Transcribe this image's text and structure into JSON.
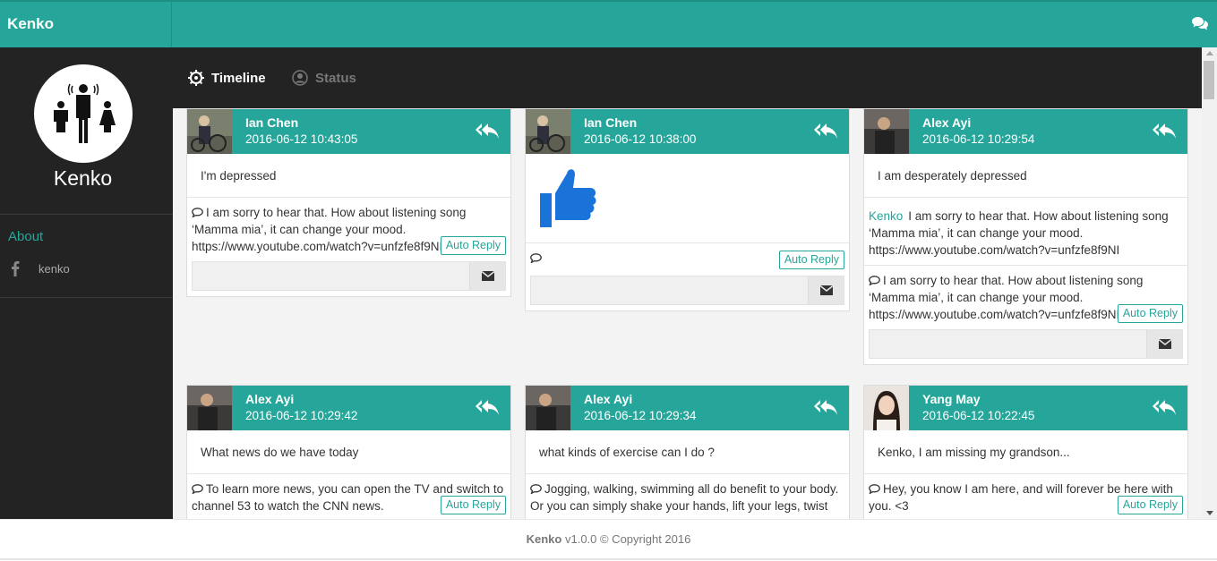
{
  "app": {
    "brand": "Kenko",
    "chat_icon": "comments-icon"
  },
  "sidebar": {
    "name": "Kenko",
    "about_label": "About",
    "facebook_label": "kenko",
    "facebook_icon": "facebook-icon"
  },
  "tabs": [
    {
      "label": "Timeline",
      "icon": "settings-wheel-icon",
      "active": true
    },
    {
      "label": "Status",
      "icon": "user-circle-icon",
      "active": false
    }
  ],
  "posts": [
    {
      "user": "Ian Chen",
      "time": "2016-06-12 10:43:05",
      "message": "I'm depressed",
      "replies": [
        {
          "prefix": "",
          "text": "I am sorry to hear that. How about listening song ‘Mamma mia’, it can change your mood. https://www.youtube.com/watch?v=unfzfe8f9NI",
          "button": "Auto Reply"
        }
      ]
    },
    {
      "user": "Ian Chen",
      "time": "2016-06-12 10:38:00",
      "message": "",
      "thumb": "thumbs-up-icon",
      "replies": [
        {
          "prefix": "",
          "text": "",
          "button": "Auto Reply"
        }
      ]
    },
    {
      "user": "Alex Ayi",
      "time": "2016-06-12 10:29:54",
      "message": "I am desperately depressed",
      "replies": [
        {
          "prefix": "Kenko",
          "text": "I am sorry to hear that. How about listening song ‘Mamma mia’, it can change your mood. https://www.youtube.com/watch?v=unfzfe8f9NI",
          "button": ""
        },
        {
          "prefix": "",
          "text": "I am sorry to hear that. How about listening song ‘Mamma mia’, it can change your mood. https://www.youtube.com/watch?v=unfzfe8f9NI",
          "button": "Auto Reply"
        }
      ]
    },
    {
      "user": "Alex Ayi",
      "time": "2016-06-12 10:29:42",
      "message": "What news do we have today",
      "replies": [
        {
          "prefix": "",
          "text": "To learn more news, you can open the TV and switch to channel 53 to watch the CNN news.",
          "button": "Auto Reply"
        }
      ]
    },
    {
      "user": "Alex Ayi",
      "time": "2016-06-12 10:29:34",
      "message": "what kinds of exercise can I do ?",
      "replies": [
        {
          "prefix": "",
          "text": "Jogging, walking, swimming all do benefit to your body. Or you can simply shake your hands, lift your legs, twist",
          "button": ""
        }
      ]
    },
    {
      "user": "Yang May",
      "time": "2016-06-12 10:22:45",
      "message": "Kenko, I am missing my grandson...",
      "replies": [
        {
          "prefix": "",
          "text": "Hey, you know I am here, and will forever be here with you. <3",
          "button": "Auto Reply"
        }
      ]
    }
  ],
  "footer": {
    "brand": "Kenko",
    "text": " v1.0.0 © Copyright 2016"
  },
  "colors": {
    "accent": "#26a69a",
    "dark": "#232323",
    "background": "#f3f3f3"
  }
}
